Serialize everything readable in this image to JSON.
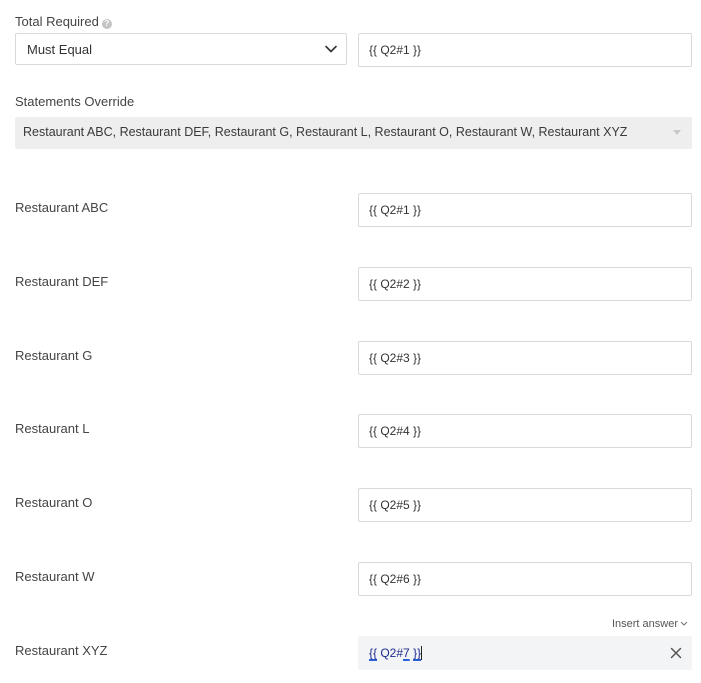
{
  "total_required": {
    "label": "Total Required",
    "help_icon": "question-circle-icon",
    "select_value": "Must Equal",
    "value": "{{ Q2#1 }}"
  },
  "statements_override": {
    "label": "Statements Override",
    "value": "Restaurant ABC, Restaurant DEF, Restaurant G, Restaurant L, Restaurant O, Restaurant W, Restaurant XYZ"
  },
  "rows": [
    {
      "label": "Restaurant ABC",
      "value": "{{ Q2#1 }}"
    },
    {
      "label": "Restaurant DEF",
      "value": "{{ Q2#2 }}"
    },
    {
      "label": "Restaurant G",
      "value": "{{ Q2#3 }}"
    },
    {
      "label": "Restaurant L",
      "value": "{{ Q2#4 }}"
    },
    {
      "label": "Restaurant O",
      "value": "{{ Q2#5 }}"
    },
    {
      "label": "Restaurant W",
      "value": "{{ Q2#6 }}"
    },
    {
      "label": "Restaurant XYZ",
      "value_parts": [
        "{{",
        " Q2#",
        "7",
        " }}"
      ]
    }
  ],
  "insert_answer": {
    "label": "Insert answer"
  },
  "colors": {
    "token_underline": "#2b62d9",
    "active_field_bg": "#f3f4f6",
    "disabled_bg": "#eeeeee"
  }
}
